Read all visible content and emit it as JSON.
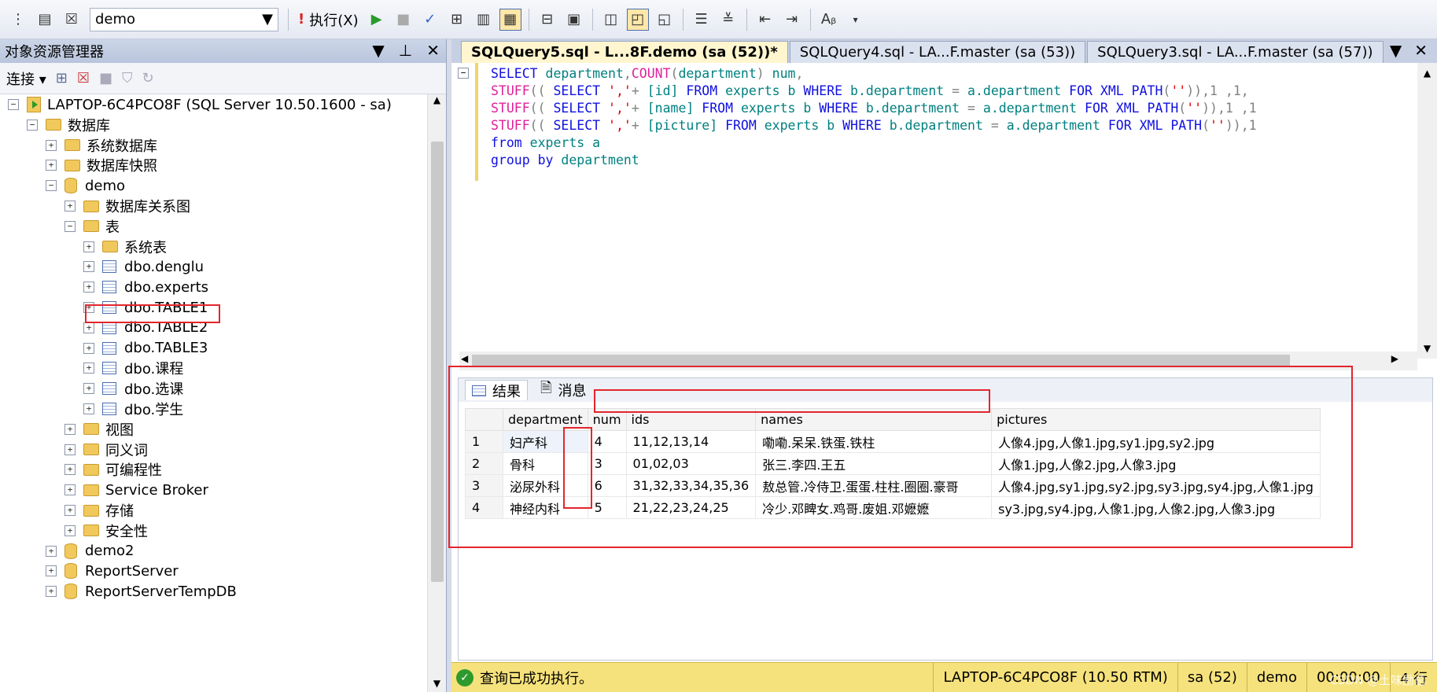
{
  "toolbar": {
    "database": "demo",
    "execute_label": "执行(X)"
  },
  "object_explorer": {
    "title": "对象资源管理器",
    "connect_label": "连接",
    "tree": [
      {
        "label": "LAPTOP-6C4PCO8F (SQL Server 10.50.1600 - sa)",
        "icon": "server-icon",
        "expander": "minus"
      },
      {
        "label": "数据库",
        "icon": "folder-icon",
        "expander": "minus"
      },
      {
        "label": "系统数据库",
        "icon": "folder-icon",
        "expander": "plus"
      },
      {
        "label": "数据库快照",
        "icon": "folder-icon",
        "expander": "plus"
      },
      {
        "label": "demo",
        "icon": "database-icon",
        "expander": "minus"
      },
      {
        "label": "数据库关系图",
        "icon": "folder-icon",
        "expander": "plus"
      },
      {
        "label": "表",
        "icon": "folder-icon",
        "expander": "minus"
      },
      {
        "label": "系统表",
        "icon": "folder-icon",
        "expander": "plus"
      },
      {
        "label": "dbo.denglu",
        "icon": "table-icon",
        "expander": "plus"
      },
      {
        "label": "dbo.experts",
        "icon": "table-icon",
        "expander": "plus"
      },
      {
        "label": "dbo.TABLE1",
        "icon": "table-icon",
        "expander": "plus"
      },
      {
        "label": "dbo.TABLE2",
        "icon": "table-icon",
        "expander": "plus"
      },
      {
        "label": "dbo.TABLE3",
        "icon": "table-icon",
        "expander": "plus"
      },
      {
        "label": "dbo.课程",
        "icon": "table-icon",
        "expander": "plus"
      },
      {
        "label": "dbo.选课",
        "icon": "table-icon",
        "expander": "plus"
      },
      {
        "label": "dbo.学生",
        "icon": "table-icon",
        "expander": "plus"
      },
      {
        "label": "视图",
        "icon": "folder-icon",
        "expander": "plus"
      },
      {
        "label": "同义词",
        "icon": "folder-icon",
        "expander": "plus"
      },
      {
        "label": "可编程性",
        "icon": "folder-icon",
        "expander": "plus"
      },
      {
        "label": "Service Broker",
        "icon": "folder-icon",
        "expander": "plus"
      },
      {
        "label": "存储",
        "icon": "folder-icon",
        "expander": "plus"
      },
      {
        "label": "安全性",
        "icon": "folder-icon",
        "expander": "plus"
      },
      {
        "label": "demo2",
        "icon": "database-icon",
        "expander": "plus"
      },
      {
        "label": "ReportServer",
        "icon": "database-icon",
        "expander": "plus"
      },
      {
        "label": "ReportServerTempDB",
        "icon": "database-icon",
        "expander": "plus"
      }
    ]
  },
  "editor": {
    "tabs": [
      {
        "label": "SQLQuery5.sql - L...8F.demo (sa (52))*",
        "active": true
      },
      {
        "label": "SQLQuery4.sql - LA...F.master (sa (53))",
        "active": false
      },
      {
        "label": "SQLQuery3.sql - LA...F.master (sa (57))",
        "active": false
      }
    ],
    "code": [
      {
        "segments": [
          [
            "kw",
            "SELECT "
          ],
          [
            "id",
            "department"
          ],
          [
            "gray",
            ","
          ],
          [
            "fn",
            "COUNT"
          ],
          [
            "gray",
            "("
          ],
          [
            "id",
            "department"
          ],
          [
            "gray",
            ")"
          ],
          [
            "id",
            " num"
          ],
          [
            "gray",
            ","
          ]
        ]
      },
      {
        "segments": [
          [
            "fn",
            "STUFF"
          ],
          [
            "gray",
            "(( "
          ],
          [
            "kw",
            "SELECT "
          ],
          [
            "str",
            "','"
          ],
          [
            "gray",
            "+ "
          ],
          [
            "id",
            "[id] "
          ],
          [
            "kw",
            "FROM "
          ],
          [
            "id",
            "experts b "
          ],
          [
            "kw",
            "WHERE "
          ],
          [
            "id",
            "b.department "
          ],
          [
            "gray",
            "= "
          ],
          [
            "id",
            "a.department "
          ],
          [
            "kw",
            "FOR XML PATH"
          ],
          [
            "gray",
            "("
          ],
          [
            "str",
            "''"
          ],
          [
            "gray",
            "))"
          ],
          [
            "gray",
            ",1 ,1,"
          ]
        ]
      },
      {
        "segments": [
          [
            "fn",
            "STUFF"
          ],
          [
            "gray",
            "(( "
          ],
          [
            "kw",
            "SELECT "
          ],
          [
            "str",
            "','"
          ],
          [
            "gray",
            "+ "
          ],
          [
            "id",
            "[name] "
          ],
          [
            "kw",
            "FROM "
          ],
          [
            "id",
            "experts b "
          ],
          [
            "kw",
            "WHERE "
          ],
          [
            "id",
            "b.department "
          ],
          [
            "gray",
            "= "
          ],
          [
            "id",
            "a.department "
          ],
          [
            "kw",
            "FOR XML PATH"
          ],
          [
            "gray",
            "("
          ],
          [
            "str",
            "''"
          ],
          [
            "gray",
            "))"
          ],
          [
            "gray",
            ",1 ,1"
          ]
        ]
      },
      {
        "segments": [
          [
            "fn",
            "STUFF"
          ],
          [
            "gray",
            "(( "
          ],
          [
            "kw",
            "SELECT "
          ],
          [
            "str",
            "','"
          ],
          [
            "gray",
            "+ "
          ],
          [
            "id",
            "[picture] "
          ],
          [
            "kw",
            "FROM "
          ],
          [
            "id",
            "experts b "
          ],
          [
            "kw",
            "WHERE "
          ],
          [
            "id",
            "b.department "
          ],
          [
            "gray",
            "= "
          ],
          [
            "id",
            "a.department "
          ],
          [
            "kw",
            "FOR XML PATH"
          ],
          [
            "gray",
            "("
          ],
          [
            "str",
            "''"
          ],
          [
            "gray",
            "))"
          ],
          [
            "gray",
            ",1"
          ]
        ]
      },
      {
        "segments": [
          [
            "kw",
            "from "
          ],
          [
            "id",
            "experts a"
          ]
        ]
      },
      {
        "segments": [
          [
            "kw",
            "group by "
          ],
          [
            "id",
            "department"
          ]
        ]
      }
    ]
  },
  "results": {
    "tabs": [
      "结果",
      "消息"
    ],
    "columns": [
      "department",
      "num",
      "ids",
      "names",
      "pictures"
    ],
    "rows": [
      [
        "1",
        "妇产科",
        "4",
        "11,12,13,14",
        "嘞嘞.呆呆.铁蛋.铁柱",
        "人像4.jpg,人像1.jpg,sy1.jpg,sy2.jpg"
      ],
      [
        "2",
        "骨科",
        "3",
        "01,02,03",
        "张三.李四.王五",
        "人像1.jpg,人像2.jpg,人像3.jpg"
      ],
      [
        "3",
        "泌尿外科",
        "6",
        "31,32,33,34,35,36",
        "敖总管.冷侍卫.蛋蛋.柱柱.圈圈.豪哥",
        "人像4.jpg,sy1.jpg,sy2.jpg,sy3.jpg,sy4.jpg,人像1.jpg"
      ],
      [
        "4",
        "神经内科",
        "5",
        "21,22,23,24,25",
        "冷少.邓睥女.鸡哥.废姐.邓嬷嬷",
        "sy3.jpg,sy4.jpg,人像1.jpg,人像2.jpg,人像3.jpg"
      ]
    ]
  },
  "status": {
    "message": "查询已成功执行。",
    "server": "LAPTOP-6C4PCO8F (10.50 RTM)",
    "user": "sa (52)",
    "database": "demo",
    "time": "00:00:00",
    "rows": "4 行"
  },
  "watermark": "CSDN @土味励总"
}
